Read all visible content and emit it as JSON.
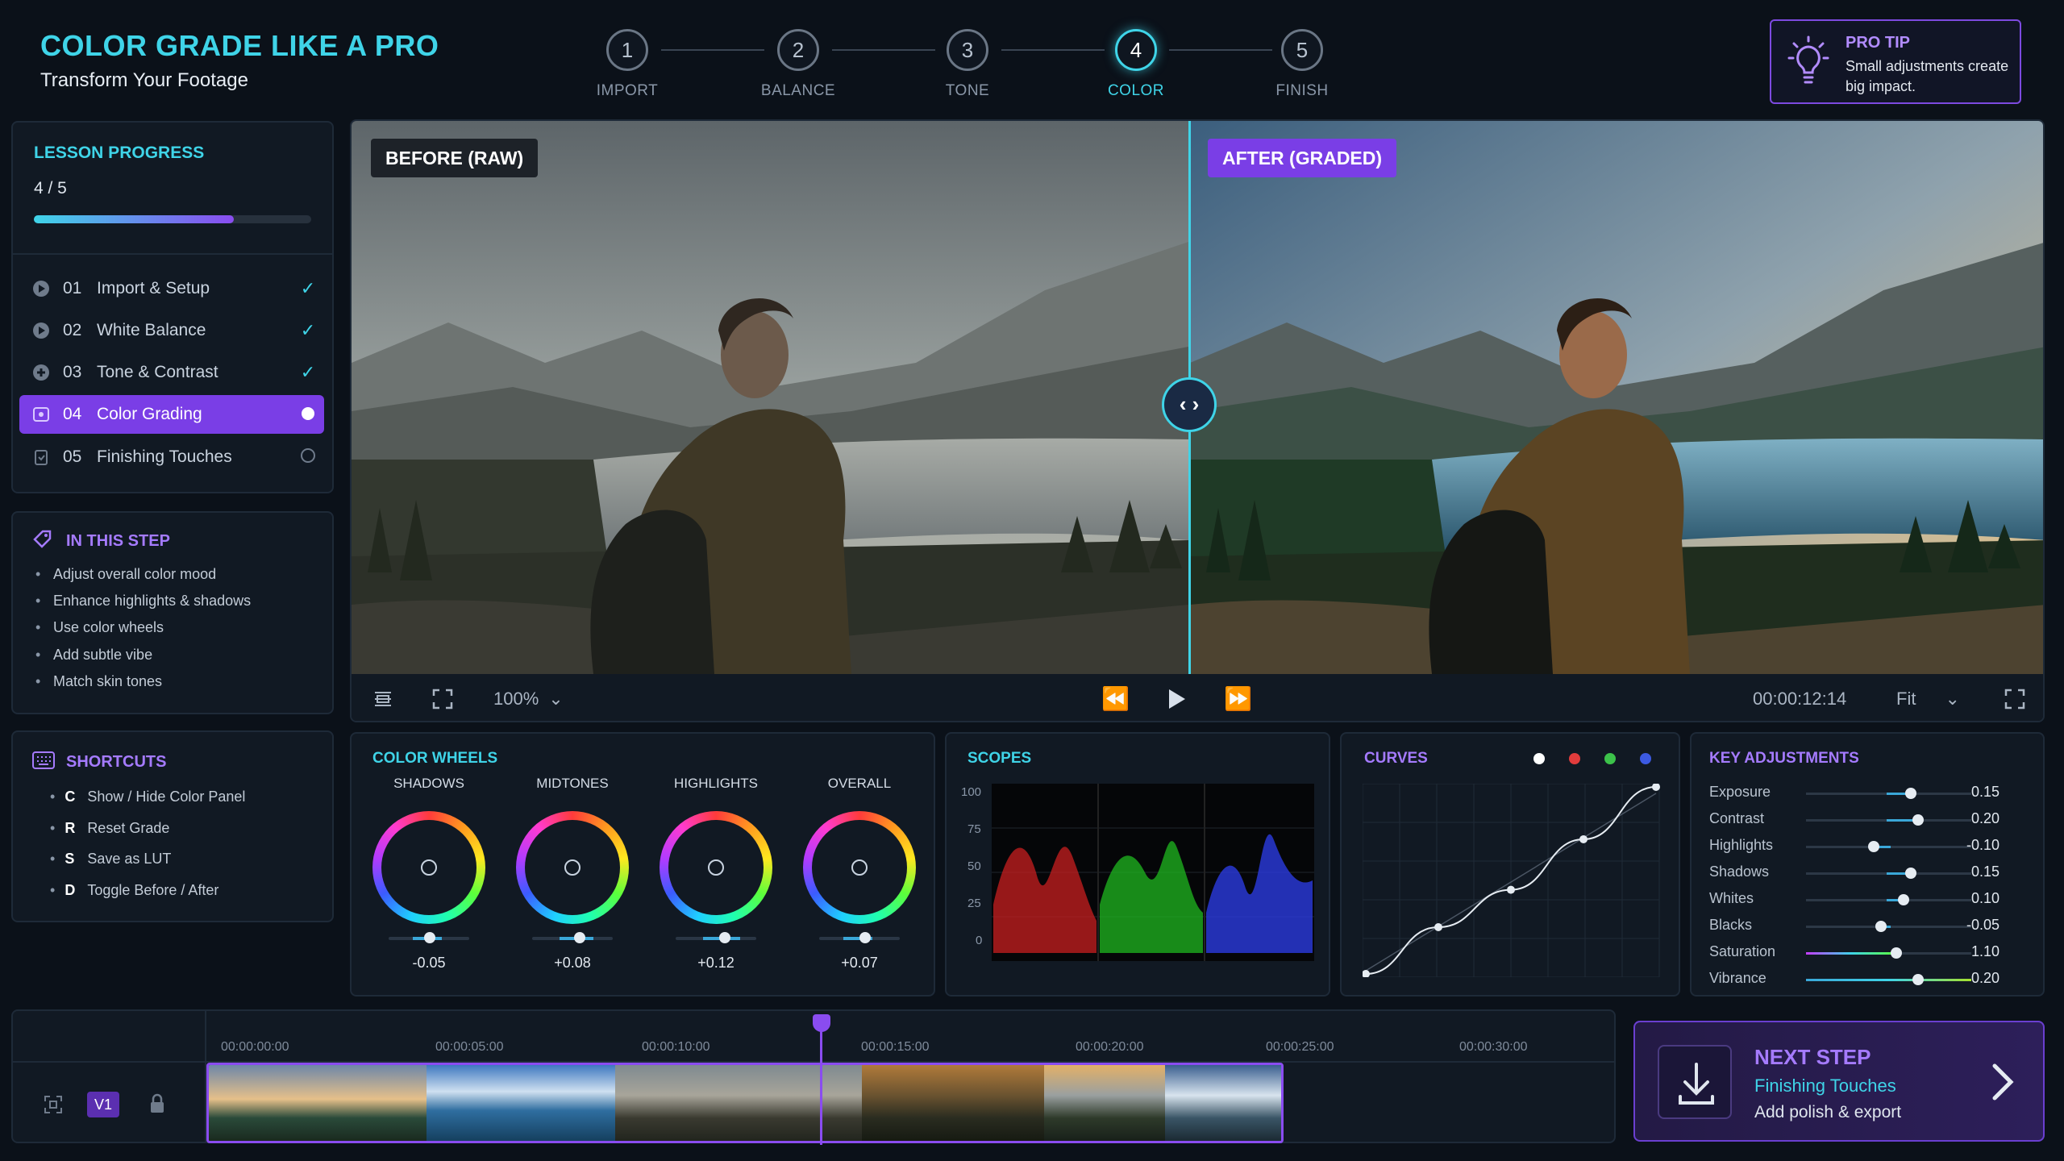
{
  "header": {
    "title": "COLOR GRADE LIKE A PRO",
    "subtitle": "Transform Your Footage"
  },
  "steps": [
    {
      "num": "1",
      "label": "IMPORT"
    },
    {
      "num": "2",
      "label": "BALANCE"
    },
    {
      "num": "3",
      "label": "TONE"
    },
    {
      "num": "4",
      "label": "COLOR"
    },
    {
      "num": "5",
      "label": "FINISH"
    }
  ],
  "active_step": 4,
  "pro_tip": {
    "title": "PRO TIP",
    "text": "Small adjustments create big impact."
  },
  "lesson_progress": {
    "title": "LESSON PROGRESS",
    "count": "4 / 5",
    "fraction": 0.8
  },
  "lessons": [
    {
      "num": "01",
      "name": "Import & Setup",
      "status": "done"
    },
    {
      "num": "02",
      "name": "White Balance",
      "status": "done"
    },
    {
      "num": "03",
      "name": "Tone & Contrast",
      "status": "done"
    },
    {
      "num": "04",
      "name": "Color Grading",
      "status": "active"
    },
    {
      "num": "05",
      "name": "Finishing Touches",
      "status": "pending"
    }
  ],
  "in_this_step": {
    "title": "IN THIS STEP",
    "items": [
      "Adjust overall color mood",
      "Enhance highlights & shadows",
      "Use color wheels",
      "Add subtle vibe",
      "Match skin tones"
    ]
  },
  "shortcuts": {
    "title": "SHORTCUTS",
    "items": [
      {
        "key": "C",
        "label": "Show / Hide Color Panel"
      },
      {
        "key": "R",
        "label": "Reset Grade"
      },
      {
        "key": "S",
        "label": "Save as LUT"
      },
      {
        "key": "D",
        "label": "Toggle Before / After"
      }
    ]
  },
  "viewer": {
    "before_label": "BEFORE (RAW)",
    "after_label": "AFTER (GRADED)",
    "zoom": "100%",
    "timecode": "00:00:12:14",
    "fit": "Fit"
  },
  "color_wheels": {
    "title": "COLOR WHEELS",
    "wheels": [
      {
        "label": "SHADOWS",
        "value": "-0.05"
      },
      {
        "label": "MIDTONES",
        "value": "+0.08"
      },
      {
        "label": "HIGHLIGHTS",
        "value": "+0.12"
      },
      {
        "label": "OVERALL",
        "value": "+0.07"
      }
    ]
  },
  "scopes": {
    "title": "SCOPES",
    "ticks": [
      "100",
      "75",
      "50",
      "25",
      "0"
    ]
  },
  "curves": {
    "title": "CURVES",
    "channel_colors": [
      "#ffffff",
      "#e23c3c",
      "#3cc24a",
      "#3c5ae2"
    ],
    "points": [
      [
        0,
        0
      ],
      [
        0.25,
        0.25
      ],
      [
        0.5,
        0.45
      ],
      [
        0.75,
        0.72
      ],
      [
        1,
        1
      ]
    ]
  },
  "key_adjustments": {
    "title": "KEY ADJUSTMENTS",
    "items": [
      {
        "name": "Exposure",
        "value": "0.15",
        "num": 0.15
      },
      {
        "name": "Contrast",
        "value": "0.20",
        "num": 0.2
      },
      {
        "name": "Highlights",
        "value": "-0.10",
        "num": -0.1
      },
      {
        "name": "Shadows",
        "value": "0.15",
        "num": 0.15
      },
      {
        "name": "Whites",
        "value": "0.10",
        "num": 0.1
      },
      {
        "name": "Blacks",
        "value": "-0.05",
        "num": -0.05
      },
      {
        "name": "Saturation",
        "value": "1.10",
        "num": 1.1
      },
      {
        "name": "Vibrance",
        "value": "0.20",
        "num": 0.2
      }
    ]
  },
  "timeline": {
    "track": "V1",
    "timecodes": [
      "00:00:00:00",
      "00:00:05:00",
      "00:00:10:00",
      "00:00:15:00",
      "00:00:20:00",
      "00:00:25:00",
      "00:00:30:00"
    ]
  },
  "next_step": {
    "title": "NEXT STEP",
    "name": "Finishing Touches",
    "desc": "Add polish & export"
  },
  "colors": {
    "accent": "#3fd4e8",
    "brand_purple": "#7a3ee6",
    "background": "#0b1119"
  }
}
